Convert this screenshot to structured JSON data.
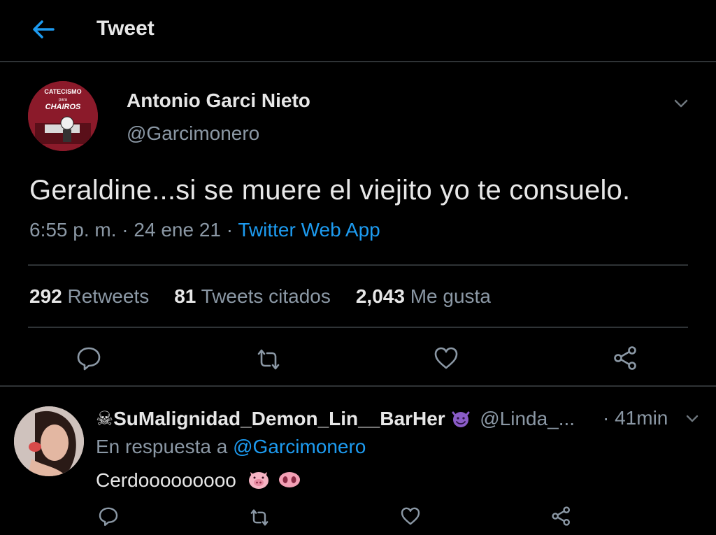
{
  "header": {
    "title": "Tweet"
  },
  "tweet": {
    "author_name": "Antonio Garci Nieto",
    "author_handle": "@Garcimonero",
    "avatar_text": [
      "CATECISMO",
      "para",
      "CHAIROS"
    ],
    "text": "Geraldine...si se muere el viejito yo te consuelo.",
    "time": "6:55 p. m.",
    "date": "24 ene 21",
    "source": "Twitter Web App",
    "stats": [
      {
        "count": "292",
        "label": "Retweets"
      },
      {
        "count": "81",
        "label": "Tweets citados"
      },
      {
        "count": "2,043",
        "label": "Me gusta"
      }
    ]
  },
  "reply": {
    "name": "SuMalignidad_Demon_Lin__BarHer",
    "handle": "@Linda_...",
    "time": "41min",
    "reply_prefix": "En respuesta a",
    "reply_to": "@Garcimonero",
    "text": "Cerdooooooooo"
  },
  "colors": {
    "background": "#000000",
    "accent": "#1d9bf0",
    "muted": "#8b98a5",
    "divider": "#2f3336"
  }
}
